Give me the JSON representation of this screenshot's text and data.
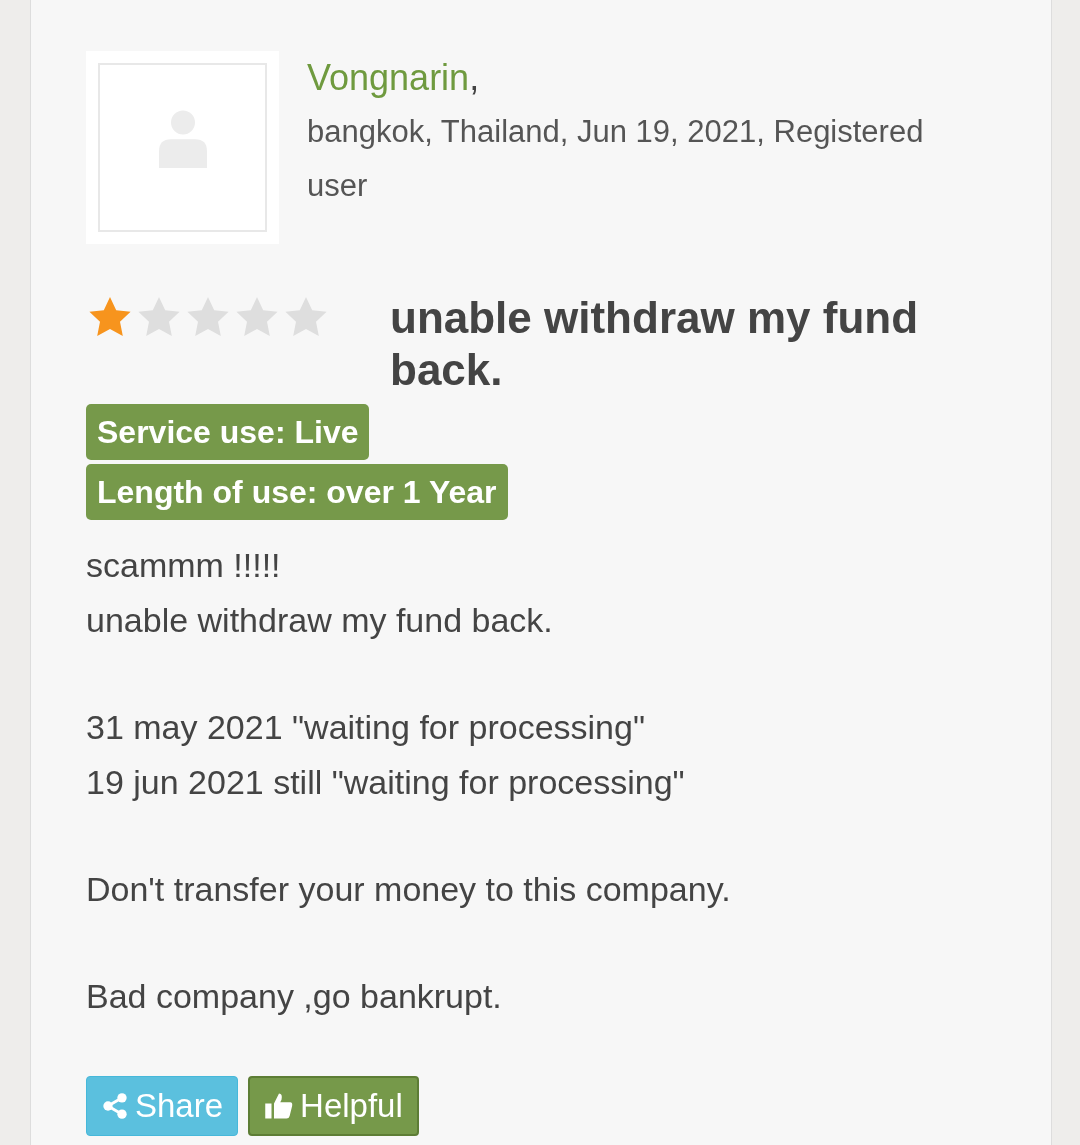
{
  "review": {
    "author": "Vongnarin",
    "author_suffix": ",",
    "meta": "bangkok, Thailand, Jun 19, 2021, Registered user",
    "stars": 1,
    "title": "unable withdraw my fund back.",
    "tags": [
      "Service use: Live",
      "Length of use: over 1 Year"
    ],
    "body": [
      [
        "scammm !!!!!",
        "unable withdraw my fund back."
      ],
      [
        "31 may 2021 \"waiting for processing\"",
        "19 jun 2021 still \"waiting for processing\""
      ],
      [
        "Don't transfer your money to this company."
      ],
      [
        "Bad company ,go bankrupt."
      ]
    ]
  },
  "buttons": [
    {
      "kind": "share",
      "label": "Share"
    },
    {
      "kind": "helpful",
      "label": "Helpful"
    }
  ]
}
